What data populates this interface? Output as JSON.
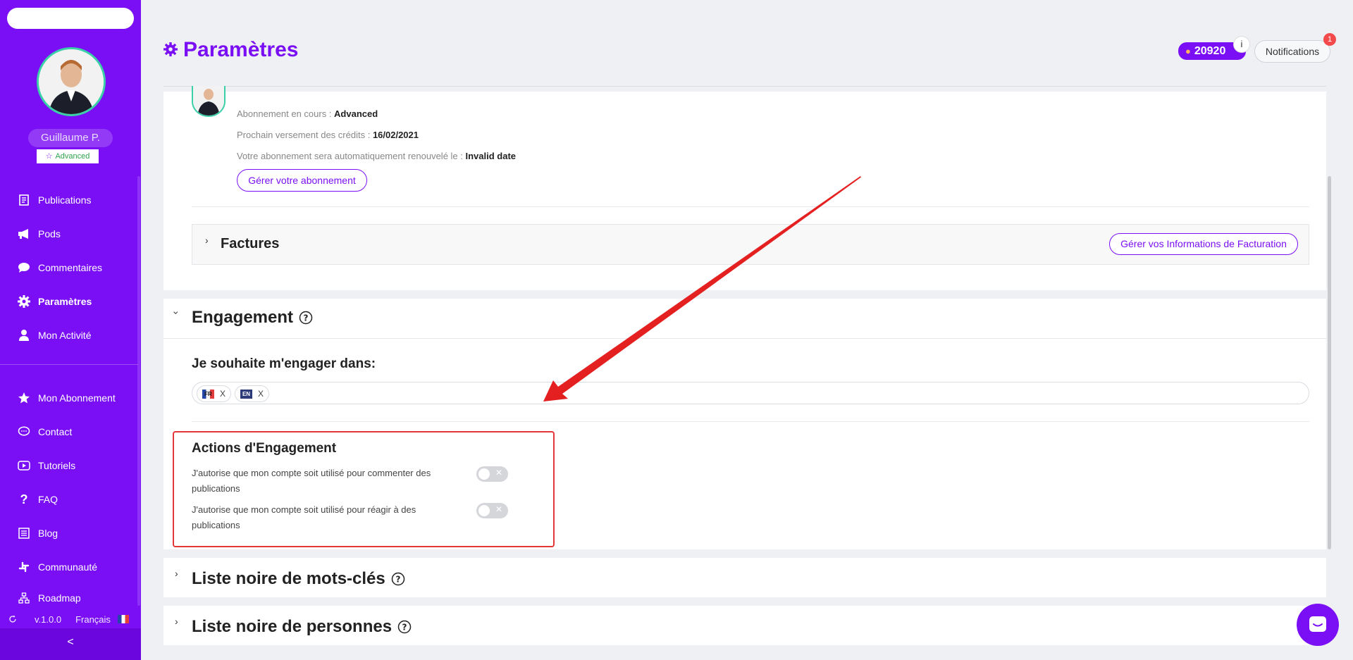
{
  "sidebar": {
    "user_name": "Guillaume P.",
    "plan_badge": "Advanced",
    "nav_top": [
      {
        "label": "Publications",
        "icon": "document-icon"
      },
      {
        "label": "Pods",
        "icon": "megaphone-icon"
      },
      {
        "label": "Commentaires",
        "icon": "comment-icon"
      },
      {
        "label": "Paramètres",
        "icon": "gear-icon",
        "active": true
      },
      {
        "label": "Mon Activité",
        "icon": "user-icon"
      }
    ],
    "nav_bottom": [
      {
        "label": "Mon Abonnement",
        "icon": "star-icon"
      },
      {
        "label": "Contact",
        "icon": "chat-bubble-icon"
      },
      {
        "label": "Tutoriels",
        "icon": "play-icon"
      },
      {
        "label": "FAQ",
        "icon": "question-icon"
      },
      {
        "label": "Blog",
        "icon": "newspaper-icon"
      },
      {
        "label": "Communauté",
        "icon": "slack-icon"
      },
      {
        "label": "Roadmap",
        "icon": "sitemap-icon"
      }
    ],
    "version": "v.1.0.0",
    "language": "Français",
    "collapse_glyph": "<"
  },
  "header": {
    "title": "Paramètres",
    "credits": "20920",
    "credits_info": "i",
    "notifications_label": "Notifications",
    "notifications_count": "1"
  },
  "subscription": {
    "current_label": "Abonnement en cours :",
    "current_value": "Advanced",
    "next_label": "Prochain versement des crédits :",
    "next_value": "16/02/2021",
    "renew_label": "Votre abonnement sera automatiquement renouvelé le :",
    "renew_value": "Invalid date",
    "manage_button": "Gérer votre abonnement"
  },
  "factures": {
    "title": "Factures",
    "billing_button": "Gérer vos Informations de Facturation"
  },
  "engagement": {
    "title": "Engagement",
    "lang_label": "Je souhaite m'engager dans:",
    "languages": [
      {
        "code": "FR",
        "remove": "X"
      },
      {
        "code": "EN",
        "remove": "X"
      }
    ],
    "actions_title": "Actions d'Engagement",
    "actions": [
      {
        "line1": "J'autorise que mon compte soit utilisé pour commenter des",
        "line2": "publications",
        "enabled": false
      },
      {
        "line1": "J'autorise que mon compte soit utilisé pour réagir à des",
        "line2": "publications",
        "enabled": false
      }
    ],
    "toggle_off_glyph": "✕"
  },
  "sections": {
    "keywords_blacklist": "Liste noire de mots-clés",
    "people_blacklist": "Liste noire de personnes"
  },
  "colors": {
    "brand": "#7a0ff5",
    "annotation": "#e33737"
  }
}
